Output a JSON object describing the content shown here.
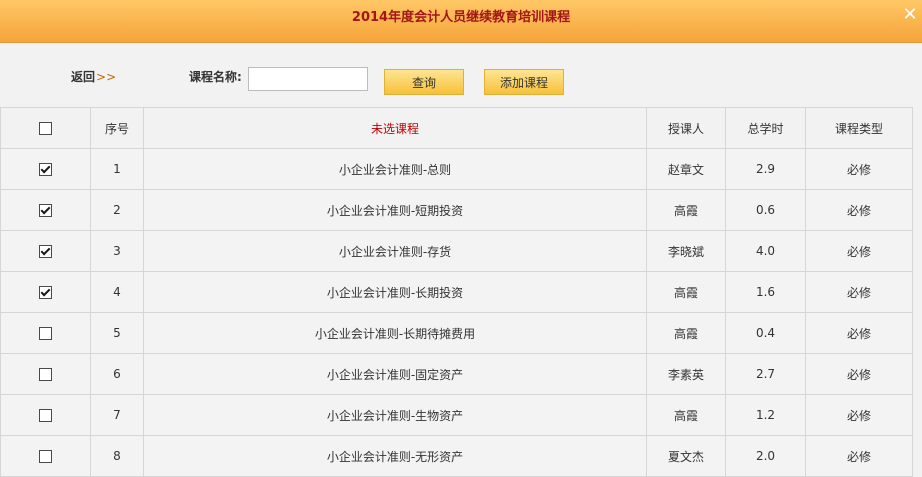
{
  "dialog": {
    "title": "2014年度会计人员继续教育培训课程",
    "close_symbol": "✕"
  },
  "toolbar": {
    "back_label": "返回",
    "back_arrows": ">>",
    "search_label": "课程名称:",
    "search_value": "",
    "query_button": "查询",
    "add_button": "添加课程"
  },
  "table": {
    "headers": {
      "index": "序号",
      "course": "未选课程",
      "teacher": "授课人",
      "hours": "总学时",
      "type": "课程类型"
    },
    "header_checked": false,
    "rows": [
      {
        "checked": true,
        "index": "1",
        "course": "小企业会计准则-总则",
        "teacher": "赵章文",
        "hours": "2.9",
        "type": "必修"
      },
      {
        "checked": true,
        "index": "2",
        "course": "小企业会计准则-短期投资",
        "teacher": "高霞",
        "hours": "0.6",
        "type": "必修"
      },
      {
        "checked": true,
        "index": "3",
        "course": "小企业会计准则-存货",
        "teacher": "李晓斌",
        "hours": "4.0",
        "type": "必修"
      },
      {
        "checked": true,
        "index": "4",
        "course": "小企业会计准则-长期投资",
        "teacher": "高霞",
        "hours": "1.6",
        "type": "必修"
      },
      {
        "checked": false,
        "index": "5",
        "course": "小企业会计准则-长期待摊费用",
        "teacher": "高霞",
        "hours": "0.4",
        "type": "必修"
      },
      {
        "checked": false,
        "index": "6",
        "course": "小企业会计准则-固定资产",
        "teacher": "李素英",
        "hours": "2.7",
        "type": "必修"
      },
      {
        "checked": false,
        "index": "7",
        "course": "小企业会计准则-生物资产",
        "teacher": "高霞",
        "hours": "1.2",
        "type": "必修"
      },
      {
        "checked": false,
        "index": "8",
        "course": "小企业会计准则-无形资产",
        "teacher": "夏文杰",
        "hours": "2.0",
        "type": "必修"
      }
    ]
  }
}
